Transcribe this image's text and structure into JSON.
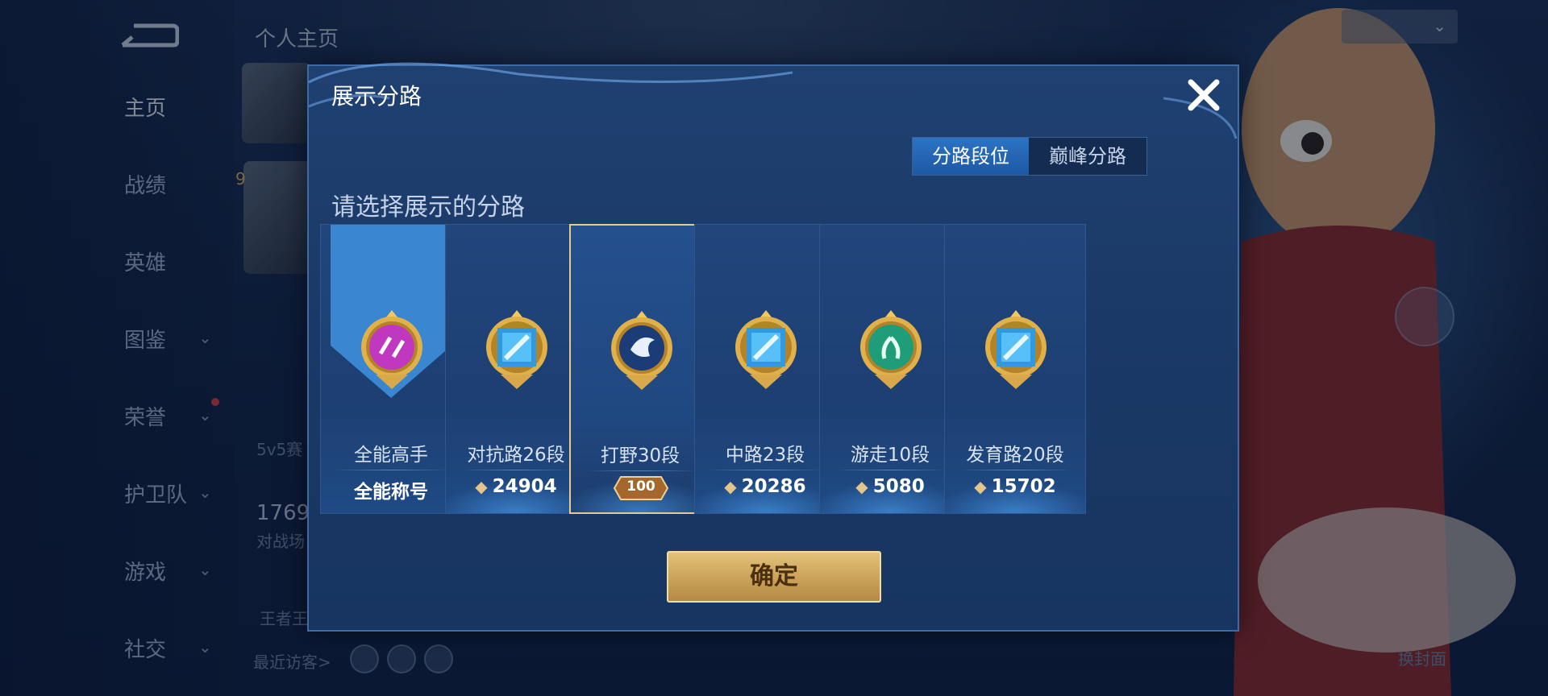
{
  "nav": {
    "items": [
      {
        "label": "主页",
        "active": true,
        "has_chevron": false
      },
      {
        "label": "战绩",
        "active": false,
        "has_chevron": false
      },
      {
        "label": "英雄",
        "active": false,
        "has_chevron": false
      },
      {
        "label": "图鉴",
        "active": false,
        "has_chevron": true
      },
      {
        "label": "荣誉",
        "active": false,
        "has_chevron": true
      },
      {
        "label": "护卫队",
        "active": false,
        "has_chevron": true
      },
      {
        "label": "游戏",
        "active": false,
        "has_chevron": true
      },
      {
        "label": "社交",
        "active": false,
        "has_chevron": true
      }
    ]
  },
  "background_page": {
    "profile_tab": "个人主页",
    "level_badge": "9",
    "mode_text": "5v5赛",
    "stat_value": "1769",
    "stat_label": "对战场",
    "king_text": "王者王",
    "recent_visitors": "最近访客>",
    "change_cover": "换封面"
  },
  "modal": {
    "title": "展示分路",
    "tabs": [
      {
        "label": "分路段位",
        "active": true
      },
      {
        "label": "巅峰分路",
        "active": false
      }
    ],
    "subtitle": "请选择展示的分路",
    "cards": [
      {
        "name": "全能高手",
        "value": "全能称号",
        "selected": false,
        "badge": "all-round-badge-icon"
      },
      {
        "name": "对抗路26段",
        "value": "24904",
        "selected": false,
        "badge": "clash-lane-badge-icon"
      },
      {
        "name": "打野30段",
        "value": "100",
        "selected": true,
        "badge": "jungle-badge-icon"
      },
      {
        "name": "中路23段",
        "value": "20286",
        "selected": false,
        "badge": "mid-lane-badge-icon"
      },
      {
        "name": "游走10段",
        "value": "5080",
        "selected": false,
        "badge": "roam-badge-icon"
      },
      {
        "name": "发育路20段",
        "value": "15702",
        "selected": false,
        "badge": "farm-lane-badge-icon"
      }
    ],
    "confirm_label": "确定"
  },
  "colors": {
    "accent_blue": "#2c74c4",
    "gold": "#caa158",
    "selected_border": "#e7c990",
    "magenta_badge": "#c038c0"
  }
}
